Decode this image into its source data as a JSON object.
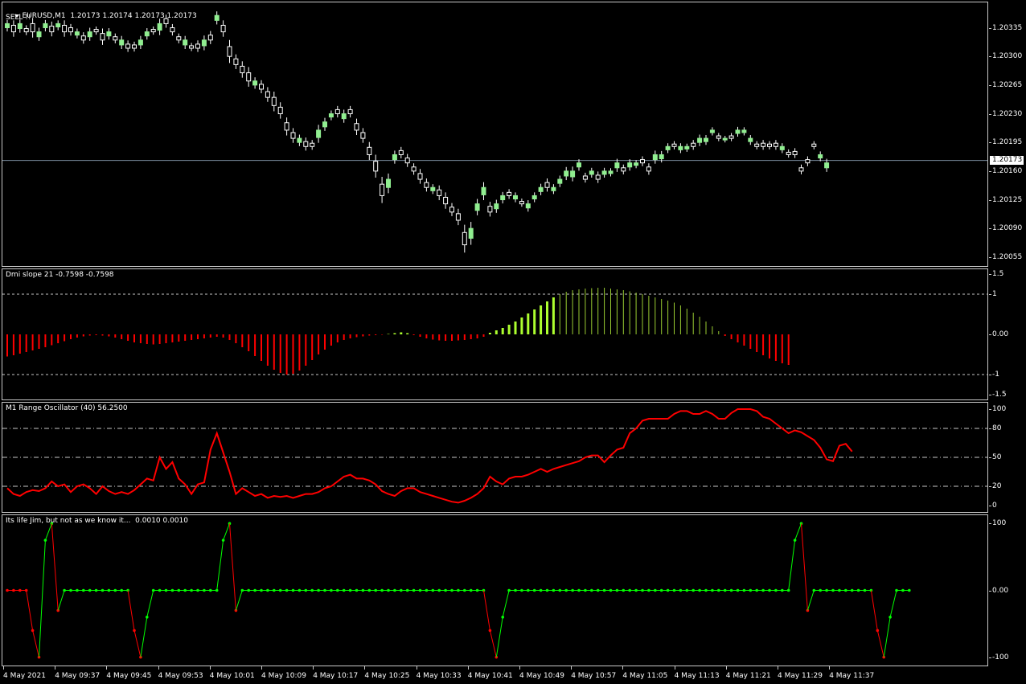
{
  "main": {
    "symbol": "EURUSD,M1",
    "ohlc": "1.20173 1.20174 1.20173 1.20173",
    "signal": "SELL !!",
    "current_price": "1.20173",
    "price_ticks": [
      "1.20335",
      "1.20300",
      "1.20265",
      "1.20230",
      "1.20195",
      "1.20160",
      "1.20125",
      "1.20090",
      "1.20055"
    ],
    "colors": {
      "bull": "#90ee90",
      "bear": "#ffffff",
      "price_line": "#778899"
    }
  },
  "dmi": {
    "label": "Dmi slope 21 -0.7598 -0.7598",
    "ticks": [
      "1.5",
      "1",
      "0.00",
      "-1",
      "-1.5"
    ],
    "colors": {
      "up_strong": "#adff2f",
      "up_weak": "#9acd32",
      "down": "#ff0000"
    }
  },
  "range_osc": {
    "label": "M1 Range Oscillator (40) 56.2500",
    "ticks": [
      "100",
      "80",
      "50",
      "20",
      "0"
    ],
    "color": "#ff0000"
  },
  "life": {
    "label": "Its life Jim, but not as we know it...  0.0010 0.0010",
    "ticks": [
      "100",
      "0.00",
      "-100"
    ],
    "colors": {
      "up": "#00ff00",
      "down": "#ff0000"
    }
  },
  "time_axis": [
    "4 May 2021",
    "4 May 09:37",
    "4 May 09:45",
    "4 May 09:53",
    "4 May 10:01",
    "4 May 10:09",
    "4 May 10:17",
    "4 May 10:25",
    "4 May 10:33",
    "4 May 10:41",
    "4 May 10:49",
    "4 May 10:57",
    "4 May 11:05",
    "4 May 11:13",
    "4 May 11:21",
    "4 May 11:29",
    "4 May 11:37"
  ],
  "chart_data": [
    {
      "type": "candlestick",
      "title": "EURUSD,M1",
      "ylim": [
        1.20048,
        1.20362
      ],
      "close": [
        1.2034,
        1.2033,
        1.2034,
        1.2033,
        1.2033,
        1.2033,
        1.2034,
        1.2033,
        1.2034,
        1.2033,
        1.2033,
        1.2033,
        1.2032,
        1.2033,
        1.2033,
        1.2032,
        1.2033,
        1.2032,
        1.2032,
        1.2031,
        1.2031,
        1.2032,
        1.2033,
        1.2033,
        1.2034,
        1.2034,
        1.2033,
        1.2032,
        1.2032,
        1.2031,
        1.2031,
        1.2032,
        1.2032,
        1.2035,
        1.2033,
        1.203,
        1.2029,
        1.2028,
        1.2027,
        1.2027,
        1.2026,
        1.2025,
        1.2024,
        1.2023,
        1.2021,
        1.202,
        1.202,
        1.2019,
        1.2019,
        1.2021,
        1.2022,
        1.2023,
        1.2023,
        1.2023,
        1.2023,
        1.2021,
        1.202,
        1.2018,
        1.2016,
        1.2013,
        1.2015,
        1.2018,
        1.2018,
        1.2017,
        1.2016,
        1.2015,
        1.2014,
        1.2014,
        1.2013,
        1.2012,
        1.2011,
        1.201,
        1.2007,
        1.2009,
        1.2012,
        1.2014,
        1.2011,
        1.2012,
        1.2013,
        1.2013,
        1.2013,
        1.2012,
        1.2012,
        1.2013,
        1.2014,
        1.2014,
        1.2014,
        1.2015,
        1.2016,
        1.2016,
        1.2017,
        1.2015,
        1.2016,
        1.2015,
        1.2016,
        1.2016,
        1.2017,
        1.2016,
        1.2017,
        1.2017,
        1.2017,
        1.2016,
        1.2018,
        1.2018,
        1.2019,
        1.2019,
        1.2019,
        1.2019,
        1.2019,
        1.202,
        1.202,
        1.2021,
        1.202,
        1.202,
        1.202,
        1.2021,
        1.2021,
        1.202,
        1.2019,
        1.2019,
        1.2019,
        1.2019,
        1.2019,
        1.2018,
        1.2018,
        1.2016,
        1.2017,
        1.2019,
        1.2018,
        1.2017
      ],
      "body": [
        5e-05,
        8e-05,
        6e-05,
        4e-05,
        0.0001,
        6e-05,
        5e-05,
        7e-05,
        4e-05,
        8e-05,
        5e-05,
        4e-05,
        5e-05,
        6e-05,
        3e-05,
        8e-05,
        5e-05,
        4e-05,
        6e-05,
        5e-05,
        4e-05,
        6e-05,
        5e-05,
        3e-05,
        8e-05,
        6e-05,
        5e-05,
        4e-05,
        6e-05,
        3e-05,
        5e-05,
        7e-05,
        6e-05,
        6e-05,
        8e-05,
        0.00012,
        7e-05,
        8e-05,
        0.0001,
        5e-05,
        6e-05,
        7e-05,
        0.0001,
        8e-05,
        9e-05,
        7e-05,
        5e-05,
        6e-05,
        4e-05,
        9e-05,
        6e-05,
        4e-05,
        5e-05,
        6e-05,
        5e-05,
        8e-05,
        7e-05,
        9e-05,
        0.00012,
        0.00014,
        0.0001,
        6e-05,
        5e-05,
        6e-05,
        5e-05,
        7e-05,
        6e-05,
        4e-05,
        7e-05,
        8e-05,
        6e-05,
        8e-05,
        0.00015,
        0.00012,
        8e-05,
        9e-05,
        7e-05,
        6e-05,
        5e-05,
        4e-05,
        4e-05,
        3e-05,
        5e-05,
        4e-05,
        5e-05,
        6e-05,
        4e-05,
        5e-05,
        6e-05,
        7e-05,
        5e-05,
        4e-05,
        4e-05,
        5e-05,
        4e-05,
        3e-05,
        6e-05,
        4e-05,
        5e-05,
        3e-05,
        4e-05,
        5e-05,
        6e-05,
        5e-05,
        4e-05,
        3e-05,
        4e-05,
        3e-05,
        4e-05,
        5e-05,
        4e-05,
        3e-05,
        3e-05,
        2e-05,
        3e-05,
        4e-05,
        3e-05,
        4e-05,
        3e-05,
        4e-05,
        3e-05,
        4e-05,
        4e-05,
        3e-05,
        4e-05,
        4e-05,
        4e-05,
        3e-05,
        4e-05,
        6e-05,
        3e-05,
        2e-05
      ],
      "up": [
        1,
        0,
        1,
        0,
        0,
        1,
        1,
        0,
        1,
        0,
        0,
        1,
        0,
        1,
        0,
        0,
        1,
        0,
        1,
        0,
        0,
        1,
        1,
        0,
        1,
        0,
        0,
        0,
        1,
        0,
        0,
        1,
        0,
        1,
        0,
        0,
        0,
        0,
        0,
        1,
        0,
        0,
        0,
        0,
        0,
        0,
        1,
        0,
        0,
        1,
        1,
        1,
        0,
        1,
        0,
        0,
        0,
        0,
        0,
        0,
        1,
        1,
        0,
        0,
        0,
        0,
        0,
        1,
        0,
        0,
        0,
        0,
        0,
        1,
        1,
        1,
        0,
        1,
        1,
        0,
        1,
        0,
        1,
        1,
        1,
        0,
        1,
        1,
        1,
        1,
        1,
        0,
        1,
        0,
        1,
        1,
        1,
        0,
        1,
        1,
        0,
        0,
        1,
        1,
        1,
        0,
        1,
        1,
        0,
        1,
        1,
        1,
        0,
        1,
        0,
        1,
        1,
        1,
        0,
        0,
        0,
        0,
        1,
        0,
        0,
        0,
        0,
        0,
        1,
        1,
        1,
        1
      ],
      "current": 1.20173
    },
    {
      "type": "bar",
      "title": "Dmi slope 21",
      "ylim": [
        -1.5,
        1.5
      ],
      "values": [
        -0.55,
        -0.52,
        -0.48,
        -0.44,
        -0.4,
        -0.36,
        -0.32,
        -0.27,
        -0.22,
        -0.17,
        -0.12,
        -0.08,
        -0.05,
        -0.03,
        -0.02,
        -0.03,
        -0.05,
        -0.08,
        -0.12,
        -0.16,
        -0.2,
        -0.22,
        -0.24,
        -0.25,
        -0.24,
        -0.22,
        -0.2,
        -0.18,
        -0.16,
        -0.14,
        -0.12,
        -0.1,
        -0.08,
        -0.06,
        -0.08,
        -0.14,
        -0.22,
        -0.32,
        -0.42,
        -0.54,
        -0.66,
        -0.78,
        -0.88,
        -0.96,
        -1.0,
        -0.98,
        -0.9,
        -0.78,
        -0.64,
        -0.5,
        -0.38,
        -0.28,
        -0.2,
        -0.14,
        -0.1,
        -0.07,
        -0.05,
        -0.03,
        -0.02,
        -0.01,
        0.01,
        0.03,
        0.05,
        0.03,
        -0.02,
        -0.06,
        -0.1,
        -0.13,
        -0.15,
        -0.16,
        -0.16,
        -0.15,
        -0.14,
        -0.12,
        -0.1,
        -0.06,
        0.04,
        0.1,
        0.16,
        0.24,
        0.32,
        0.42,
        0.52,
        0.62,
        0.72,
        0.82,
        0.92,
        1.0,
        1.06,
        1.1,
        1.12,
        1.14,
        1.15,
        1.16,
        1.16,
        1.14,
        1.12,
        1.1,
        1.07,
        1.04,
        1.0,
        0.96,
        0.92,
        0.88,
        0.84,
        0.79,
        0.72,
        0.64,
        0.54,
        0.44,
        0.32,
        0.2,
        0.08,
        -0.04,
        -0.12,
        -0.2,
        -0.28,
        -0.36,
        -0.44,
        -0.52,
        -0.6,
        -0.66,
        -0.72,
        -0.76
      ],
      "strong_up_until": 86
    },
    {
      "type": "line",
      "title": "M1 Range Oscillator (40)",
      "ylim": [
        -5,
        105
      ],
      "values": [
        18,
        12,
        10,
        14,
        16,
        15,
        18,
        25,
        20,
        22,
        14,
        20,
        22,
        18,
        12,
        20,
        15,
        12,
        14,
        12,
        16,
        22,
        28,
        26,
        50,
        38,
        45,
        28,
        22,
        12,
        22,
        24,
        58,
        75,
        55,
        35,
        12,
        18,
        14,
        10,
        12,
        8,
        10,
        9,
        10,
        8,
        10,
        12,
        12,
        14,
        18,
        20,
        25,
        30,
        32,
        28,
        28,
        26,
        22,
        15,
        12,
        10,
        15,
        18,
        18,
        14,
        12,
        10,
        8,
        6,
        4,
        3,
        5,
        8,
        12,
        18,
        30,
        25,
        22,
        28,
        30,
        30,
        32,
        35,
        38,
        35,
        38,
        40,
        42,
        44,
        46,
        50,
        52,
        52,
        45,
        52,
        58,
        60,
        75,
        80,
        88,
        90,
        90,
        90,
        90,
        95,
        98,
        98,
        95,
        95,
        98,
        95,
        90,
        90,
        96,
        100,
        100,
        100,
        98,
        92,
        90,
        85,
        80,
        75,
        78,
        76,
        72,
        68,
        60,
        48,
        46,
        62,
        64,
        56
      ]
    },
    {
      "type": "line",
      "title": "Its life Jim, but not as we know it...",
      "ylim": [
        -110,
        110
      ],
      "values": [
        0,
        0,
        0,
        0,
        -60,
        -100,
        75,
        100,
        -30,
        0,
        0,
        0,
        0,
        0,
        0,
        0,
        0,
        0,
        0,
        0,
        -60,
        -100,
        -40,
        0,
        0,
        0,
        0,
        0,
        0,
        0,
        0,
        0,
        0,
        0,
        75,
        100,
        -30,
        0,
        0,
        0,
        0,
        0,
        0,
        0,
        0,
        0,
        0,
        0,
        0,
        0,
        0,
        0,
        0,
        0,
        0,
        0,
        0,
        0,
        0,
        0,
        0,
        0,
        0,
        0,
        0,
        0,
        0,
        0,
        0,
        0,
        0,
        0,
        0,
        0,
        0,
        0,
        -60,
        -100,
        -40,
        0,
        0,
        0,
        0,
        0,
        0,
        0,
        0,
        0,
        0,
        0,
        0,
        0,
        0,
        0,
        0,
        0,
        0,
        0,
        0,
        0,
        0,
        0,
        0,
        0,
        0,
        0,
        0,
        0,
        0,
        0,
        0,
        0,
        0,
        0,
        0,
        0,
        0,
        0,
        0,
        0,
        0,
        0,
        0,
        0,
        75,
        100,
        -30,
        0,
        0,
        0,
        0,
        0,
        0,
        0,
        0,
        0,
        0,
        -60,
        -100,
        -40,
        0,
        0,
        0
      ]
    }
  ]
}
